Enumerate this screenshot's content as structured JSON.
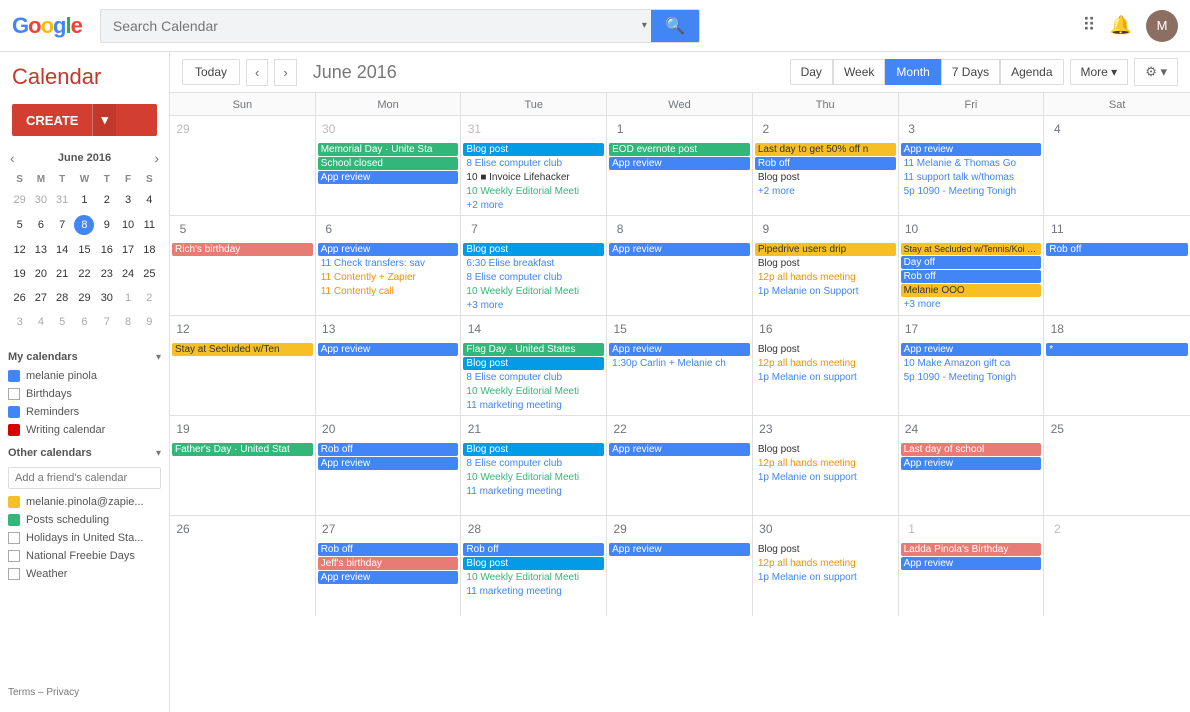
{
  "header": {
    "search_placeholder": "Search Calendar",
    "title": "Calendar"
  },
  "toolbar": {
    "today": "Today",
    "month_title": "June 2016",
    "views": [
      "Day",
      "Week",
      "Month",
      "7 Days",
      "Agenda"
    ],
    "active_view": "Month",
    "more": "More",
    "settings": "⚙"
  },
  "sidebar": {
    "title": "Calendar",
    "create_label": "CREATE",
    "mini_cal": {
      "title": "June 2016",
      "days_of_week": [
        "S",
        "M",
        "T",
        "W",
        "T",
        "F",
        "S"
      ],
      "weeks": [
        [
          {
            "n": "29",
            "other": true
          },
          {
            "n": "30",
            "other": true
          },
          {
            "n": "31",
            "other": true
          },
          {
            "n": "1"
          },
          {
            "n": "2"
          },
          {
            "n": "3"
          },
          {
            "n": "4"
          }
        ],
        [
          {
            "n": "5"
          },
          {
            "n": "6"
          },
          {
            "n": "7"
          },
          {
            "n": "8",
            "today": true
          },
          {
            "n": "9"
          },
          {
            "n": "10"
          },
          {
            "n": "11"
          }
        ],
        [
          {
            "n": "12"
          },
          {
            "n": "13"
          },
          {
            "n": "14"
          },
          {
            "n": "15"
          },
          {
            "n": "16"
          },
          {
            "n": "17"
          },
          {
            "n": "18"
          }
        ],
        [
          {
            "n": "19"
          },
          {
            "n": "20"
          },
          {
            "n": "21"
          },
          {
            "n": "22"
          },
          {
            "n": "23"
          },
          {
            "n": "24"
          },
          {
            "n": "25"
          }
        ],
        [
          {
            "n": "26"
          },
          {
            "n": "27"
          },
          {
            "n": "28"
          },
          {
            "n": "29"
          },
          {
            "n": "30"
          },
          {
            "n": "1",
            "other": true
          },
          {
            "n": "2",
            "other": true
          }
        ],
        [
          {
            "n": "3",
            "other": true
          },
          {
            "n": "4",
            "other": true
          },
          {
            "n": "5",
            "other": true
          },
          {
            "n": "6",
            "other": true
          },
          {
            "n": "7",
            "other": true
          },
          {
            "n": "8",
            "other": true
          },
          {
            "n": "9",
            "other": true
          }
        ]
      ]
    },
    "my_calendars": {
      "label": "My calendars",
      "items": [
        {
          "name": "melanie pinola",
          "color": "#4285f4",
          "checked": true
        },
        {
          "name": "Birthdays",
          "color": "",
          "checked": false
        },
        {
          "name": "Reminders",
          "color": "#4285f4",
          "checked": true
        },
        {
          "name": "Writing calendar",
          "color": "#d50000",
          "checked": true
        }
      ]
    },
    "other_calendars": {
      "label": "Other calendars",
      "add_placeholder": "Add a friend's calendar",
      "items": [
        {
          "name": "melanie.pinola@zapie...",
          "color": "#f6bf26",
          "checked": true
        },
        {
          "name": "Posts scheduling",
          "color": "#33b679",
          "checked": true
        },
        {
          "name": "Holidays in United Sta...",
          "color": "",
          "checked": false
        },
        {
          "name": "National Freebie Days",
          "color": "",
          "checked": false
        },
        {
          "name": "Weather",
          "color": "",
          "checked": false
        }
      ]
    },
    "footer": {
      "terms": "Terms",
      "privacy": "Privacy"
    }
  },
  "calendar": {
    "headers": [
      "Sun",
      "Mon",
      "Tue",
      "Wed",
      "Thu",
      "Fri",
      "Sat"
    ],
    "weeks": [
      {
        "days": [
          {
            "num": "29",
            "other": true,
            "events": []
          },
          {
            "num": "30",
            "other": true,
            "events": [
              {
                "text": "Memorial Day · Unite Sta",
                "cls": "event-allday bg-teal"
              },
              {
                "text": "School closed",
                "cls": "event-allday bg-teal"
              },
              {
                "text": "App review",
                "cls": "event-allday bg-blue"
              }
            ]
          },
          {
            "num": "31",
            "other": true,
            "events": [
              {
                "text": "Blog post",
                "cls": "event-allday bg-peacock"
              },
              {
                "text": "8 Elise computer club",
                "cls": "event-time text-blue"
              },
              {
                "text": "10 ■ Invoice Lifehacker",
                "cls": "event-time"
              },
              {
                "text": "10 Weekly Editorial Meeti",
                "cls": "event-time text-teal"
              },
              {
                "text": "+2 more",
                "cls": "more-link"
              }
            ]
          },
          {
            "num": "1",
            "events": [
              {
                "text": "EOD evernote post",
                "cls": "event-allday bg-teal"
              },
              {
                "text": "App review",
                "cls": "event-allday bg-blue"
              }
            ]
          },
          {
            "num": "2",
            "events": [
              {
                "text": "Last day to get 50% off n",
                "cls": "event-allday bg-orange"
              },
              {
                "text": "Rob off",
                "cls": "event-allday bg-blue"
              },
              {
                "text": "Blog post",
                "cls": "event-time"
              },
              {
                "text": "+2 more",
                "cls": "more-link"
              }
            ]
          },
          {
            "num": "3",
            "events": [
              {
                "text": "App review",
                "cls": "event-allday bg-blue"
              },
              {
                "text": "11 Melanie & Thomas Go",
                "cls": "event-time text-blue"
              },
              {
                "text": "11 support talk w/thomas",
                "cls": "event-time text-blue"
              },
              {
                "text": "5p 1090 - Meeting Tonigh",
                "cls": "event-time text-blue"
              }
            ]
          },
          {
            "num": "4",
            "events": []
          }
        ]
      },
      {
        "days": [
          {
            "num": "5",
            "events": [
              {
                "text": "Rich's birthday",
                "cls": "event-allday bg-flamingo"
              }
            ]
          },
          {
            "num": "6",
            "events": [
              {
                "text": "App review",
                "cls": "event-allday bg-blue"
              }
            ]
          },
          {
            "num": "7",
            "events": [
              {
                "text": "Blog post",
                "cls": "event-allday bg-peacock"
              },
              {
                "text": "6:30 Elise breakfast",
                "cls": "event-time text-blue"
              },
              {
                "text": "8 Elise computer club",
                "cls": "event-time text-blue"
              },
              {
                "text": "10 Weekly Editorial Meeti",
                "cls": "event-time text-teal"
              },
              {
                "text": "+3 more",
                "cls": "more-link"
              }
            ]
          },
          {
            "num": "8",
            "events": [
              {
                "text": "App review",
                "cls": "event-allday bg-blue"
              }
            ]
          },
          {
            "num": "9",
            "events": [
              {
                "text": "Pipedrive users drip",
                "cls": "event-allday bg-orange"
              },
              {
                "text": "Blog post",
                "cls": "event-time"
              },
              {
                "text": "12p all hands meeting",
                "cls": "event-time text-orange"
              },
              {
                "text": "1p Melanie on Support",
                "cls": "event-time text-blue"
              }
            ]
          },
          {
            "num": "10",
            "events": [
              {
                "text": "Stay at Secluded w/Tennis/Koi Pond/Hot Tub - Secl",
                "cls": "event-allday bg-banana"
              },
              {
                "text": "Day off",
                "cls": "event-allday bg-blue"
              },
              {
                "text": "Rob off",
                "cls": "event-allday bg-blue"
              },
              {
                "text": "Melanie OOO",
                "cls": "event-allday bg-orange"
              },
              {
                "text": "+3 more",
                "cls": "more-link"
              }
            ]
          },
          {
            "num": "11",
            "events": [
              {
                "text": "Rob off",
                "cls": "event-allday bg-blue"
              }
            ]
          }
        ]
      },
      {
        "days": [
          {
            "num": "12",
            "events": [
              {
                "text": "Stay at Secluded w/Ten",
                "cls": "event-allday bg-banana"
              }
            ]
          },
          {
            "num": "13",
            "events": [
              {
                "text": "App review",
                "cls": "event-allday bg-blue"
              }
            ]
          },
          {
            "num": "14",
            "events": [
              {
                "text": "Flag Day · United States",
                "cls": "event-allday bg-teal"
              },
              {
                "text": "Blog post",
                "cls": "event-allday bg-peacock"
              },
              {
                "text": "8 Elise computer club",
                "cls": "event-time text-blue"
              },
              {
                "text": "10 Weekly Editorial Meeti",
                "cls": "event-time text-teal"
              },
              {
                "text": "11 marketing meeting",
                "cls": "event-time text-blue"
              }
            ]
          },
          {
            "num": "15",
            "events": [
              {
                "text": "App review",
                "cls": "event-allday bg-blue"
              },
              {
                "text": "1:30p Carlin + Melanie ch",
                "cls": "event-time text-blue"
              }
            ]
          },
          {
            "num": "16",
            "events": [
              {
                "text": "Blog post",
                "cls": "event-time"
              },
              {
                "text": "12p all hands meeting",
                "cls": "event-time text-orange"
              },
              {
                "text": "1p Melanie on support",
                "cls": "event-time text-blue"
              }
            ]
          },
          {
            "num": "17",
            "events": [
              {
                "text": "App review",
                "cls": "event-allday bg-blue"
              },
              {
                "text": "10 Make Amazon gift ca",
                "cls": "event-time text-blue"
              },
              {
                "text": "5p 1090 - Meeting Tonigh",
                "cls": "event-time text-blue"
              }
            ]
          },
          {
            "num": "18",
            "events": [
              {
                "text": "*",
                "cls": "event-allday bg-blue"
              }
            ]
          }
        ]
      },
      {
        "days": [
          {
            "num": "19",
            "events": [
              {
                "text": "Father's Day · United Stat",
                "cls": "event-allday bg-teal"
              }
            ]
          },
          {
            "num": "20",
            "events": [
              {
                "text": "Rob off",
                "cls": "event-allday bg-blue"
              },
              {
                "text": "App review",
                "cls": "event-allday bg-blue"
              }
            ]
          },
          {
            "num": "21",
            "events": [
              {
                "text": "Blog post",
                "cls": "event-allday bg-peacock"
              },
              {
                "text": "8 Elise computer club",
                "cls": "event-time text-blue"
              },
              {
                "text": "10 Weekly Editorial Meeti",
                "cls": "event-time text-teal"
              },
              {
                "text": "11 marketing meeting",
                "cls": "event-time text-blue"
              }
            ]
          },
          {
            "num": "22",
            "events": [
              {
                "text": "App review",
                "cls": "event-allday bg-blue"
              }
            ]
          },
          {
            "num": "23",
            "events": [
              {
                "text": "Blog post",
                "cls": "event-time"
              },
              {
                "text": "12p all hands meeting",
                "cls": "event-time text-orange"
              },
              {
                "text": "1p Melanie on support",
                "cls": "event-time text-blue"
              }
            ]
          },
          {
            "num": "24",
            "events": [
              {
                "text": "Last day of school",
                "cls": "event-allday bg-flamingo"
              },
              {
                "text": "App review",
                "cls": "event-allday bg-blue"
              }
            ]
          },
          {
            "num": "25",
            "events": []
          }
        ]
      },
      {
        "days": [
          {
            "num": "26",
            "events": []
          },
          {
            "num": "27",
            "events": [
              {
                "text": "Rob off",
                "cls": "event-allday bg-blue"
              },
              {
                "text": "Jeff's birthday",
                "cls": "event-allday bg-flamingo"
              },
              {
                "text": "App review",
                "cls": "event-allday bg-blue"
              }
            ]
          },
          {
            "num": "28",
            "events": [
              {
                "text": "Rob off",
                "cls": "event-allday bg-blue"
              },
              {
                "text": "Blog post",
                "cls": "event-allday bg-peacock"
              },
              {
                "text": "10 Weekly Editorial Meeti",
                "cls": "event-time text-teal"
              },
              {
                "text": "11 marketing meeting",
                "cls": "event-time text-blue"
              }
            ]
          },
          {
            "num": "29",
            "events": [
              {
                "text": "App review",
                "cls": "event-allday bg-blue"
              }
            ]
          },
          {
            "num": "30",
            "events": [
              {
                "text": "Blog post",
                "cls": "event-time"
              },
              {
                "text": "12p all hands meeting",
                "cls": "event-time text-orange"
              },
              {
                "text": "1p Melanie on support",
                "cls": "event-time text-blue"
              }
            ]
          },
          {
            "num": "1",
            "other": true,
            "events": [
              {
                "text": "Ladda Pinola's Birthday",
                "cls": "event-allday bg-flamingo"
              },
              {
                "text": "App review",
                "cls": "event-allday bg-blue"
              }
            ]
          },
          {
            "num": "2",
            "other": true,
            "events": []
          }
        ]
      }
    ]
  }
}
